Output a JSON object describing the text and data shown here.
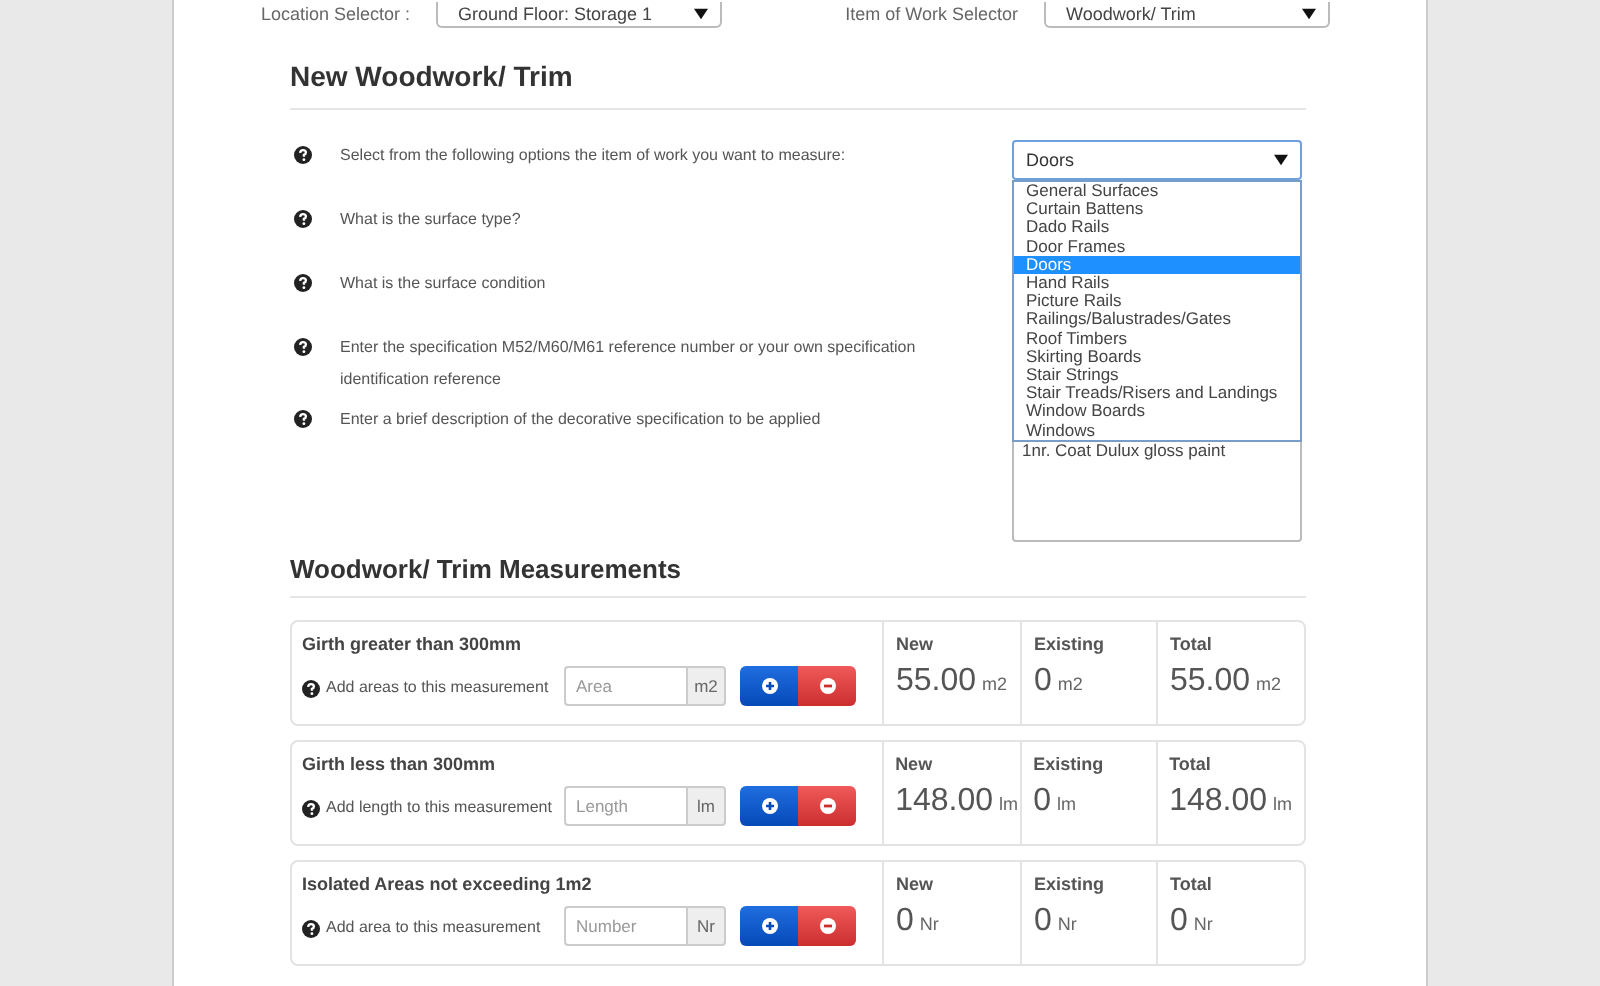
{
  "top_bar": {
    "location_label": "Location Selector :",
    "location_value": "Ground Floor: Storage 1",
    "item_label": "Item of Work Selector",
    "item_value": "Woodwork/ Trim"
  },
  "section_title": "New Woodwork/ Trim",
  "questions": [
    "Select from the following options the item of work you want to measure:",
    "What is the surface type?",
    "What is the surface condition",
    "Enter the specification M52/M60/M61 reference number or your own specification identification reference",
    "Enter a brief description of the decorative specification to be applied"
  ],
  "item_select": {
    "value": "Doors",
    "expanded": true,
    "options": [
      {
        "label": "General Surfaces",
        "selected": false
      },
      {
        "label": "Curtain Battens",
        "selected": false
      },
      {
        "label": "Dado Rails",
        "selected": false
      },
      {
        "label": "Door Frames",
        "selected": false
      },
      {
        "label": "Doors",
        "selected": true
      },
      {
        "label": "Hand Rails",
        "selected": false
      },
      {
        "label": "Picture Rails",
        "selected": false
      },
      {
        "label": "Railings/Balustrades/Gates",
        "selected": false
      },
      {
        "label": "Roof Timbers",
        "selected": false
      },
      {
        "label": "Skirting Boards",
        "selected": false
      },
      {
        "label": "Stair Strings",
        "selected": false
      },
      {
        "label": "Stair Treads/Risers and Landings",
        "selected": false
      },
      {
        "label": "Window Boards",
        "selected": false
      },
      {
        "label": "Windows",
        "selected": false
      }
    ]
  },
  "description": {
    "value": "1nr. Coat Dulux gloss paint"
  },
  "measurements_title": "Woodwork/ Trim Measurements",
  "measurements": [
    {
      "title": "Girth greater than 300mm",
      "help": "Add areas to this measurement",
      "placeholder": "Area",
      "unit": "m2",
      "columns": [
        {
          "label": "New",
          "value": "55.00",
          "unit": "m2"
        },
        {
          "label": "Existing",
          "value": "0",
          "unit": "m2"
        },
        {
          "label": "Total",
          "value": "55.00",
          "unit": "m2"
        }
      ]
    },
    {
      "title": "Girth less than 300mm",
      "help": "Add length to this measurement",
      "placeholder": "Length",
      "unit": "lm",
      "columns": [
        {
          "label": "New",
          "value": "148.00",
          "unit": "lm"
        },
        {
          "label": "Existing",
          "value": "0",
          "unit": "lm"
        },
        {
          "label": "Total",
          "value": "148.00",
          "unit": "lm"
        }
      ]
    },
    {
      "title": "Isolated Areas not exceeding 1m2",
      "help": "Add area to this measurement",
      "placeholder": "Number",
      "unit": "Nr",
      "columns": [
        {
          "label": "New",
          "value": "0",
          "unit": "Nr"
        },
        {
          "label": "Existing",
          "value": "0",
          "unit": "Nr"
        },
        {
          "label": "Total",
          "value": "0",
          "unit": "Nr"
        }
      ]
    }
  ]
}
